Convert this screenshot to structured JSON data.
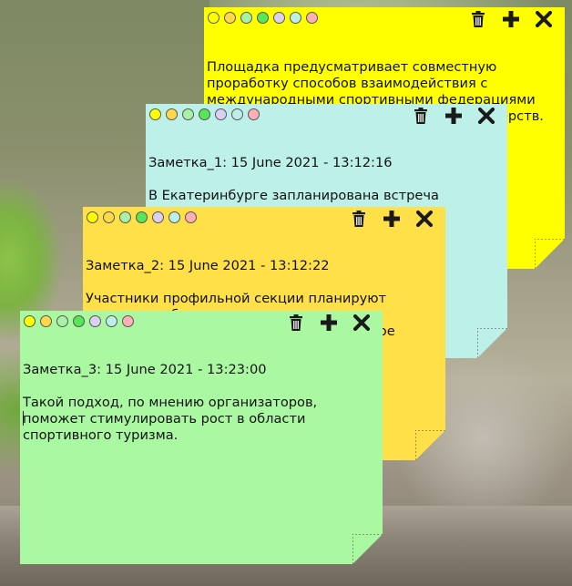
{
  "palette": {
    "dots": [
      "#ffff00",
      "#ffd84a",
      "#a7f2a7",
      "#57e657",
      "#dcd0f0",
      "#bdeee8",
      "#ffb0b6"
    ]
  },
  "icons": {
    "delete": "trash-icon",
    "add": "plus-icon",
    "close": "close-icon"
  },
  "notes": [
    {
      "color": "#ffff00",
      "text": "Площадка предусматривает совместную\nпроработку способов взаимодействия с\nмеждународными спортивными федерациями\nс привлечением руководителей и министерств."
    },
    {
      "color": "#bdf0e8",
      "title": "Заметка_1: 15 June 2021 - 13:12:16",
      "text": "В Екатеринбурге запланирована встреча\nминистров спорта из разных стран."
    },
    {
      "color": "#ffe049",
      "title": "Заметка_2: 15 June 2021 - 13:12:22",
      "text": "Участники профильной секции планируют\nизучить проблемы стран и регионов,\nвовлеченных в международное спортивное"
    },
    {
      "color": "#aaf9a2",
      "title": "Заметка_3: 15 June 2021 - 13:23:00",
      "text": "Такой подход, по мнению организаторов,\nпоможет стимулировать рост в области\nспортивного туризма."
    }
  ]
}
